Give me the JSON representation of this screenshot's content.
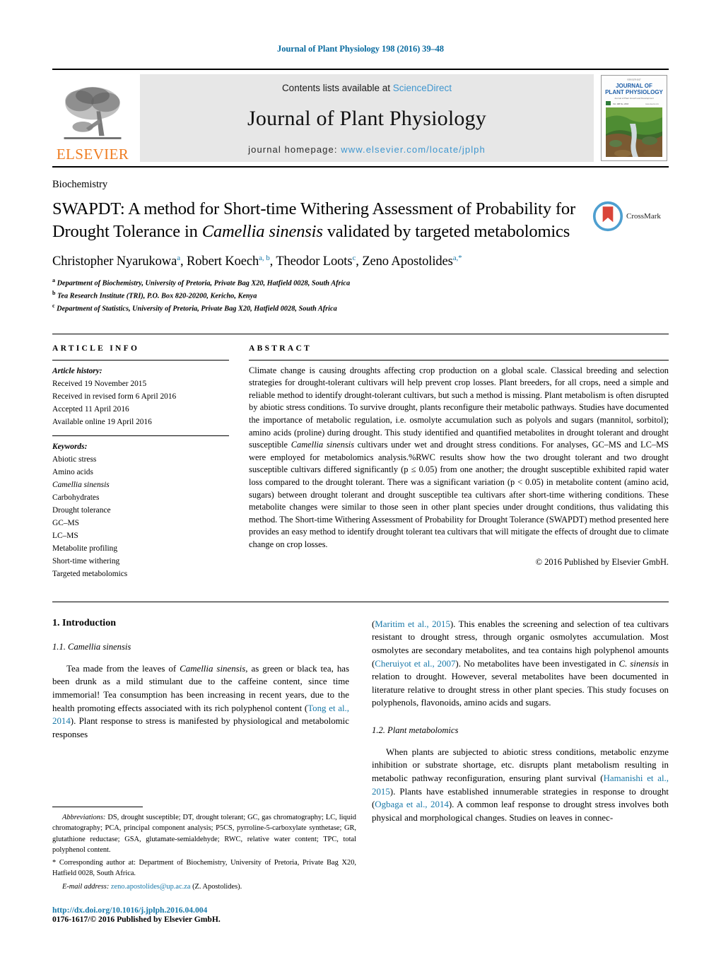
{
  "running_head": "Journal of Plant Physiology 198 (2016) 39–48",
  "masthead": {
    "contents_prefix": "Contents lists available at ",
    "sciencedirect": "ScienceDirect",
    "journal_name": "Journal of Plant Physiology",
    "homepage_prefix": "journal homepage: ",
    "homepage_url": "www.elsevier.com/locate/jplph",
    "publisher_wordmark": "ELSEVIER",
    "publisher_logo_icon": "elsevier-tree-icon",
    "cover_thumbnail_icon": "journal-cover-thumbnail",
    "cover_title_line1": "JOURNAL OF",
    "cover_title_line2": "PLANT PHYSIOLOGY"
  },
  "subject_category": "Biochemistry",
  "title": {
    "part1": "SWAPDT: A method for Short-time Withering Assessment of Probability for Drought Tolerance in ",
    "italic": "Camellia sinensis",
    "part2": " validated by targeted metabolomics"
  },
  "crossmark": {
    "label": "CrossMark",
    "icon": "crossmark-icon"
  },
  "authors": [
    {
      "name": "Christopher Nyarukowa",
      "marks": "a",
      "sep": ", "
    },
    {
      "name": "Robert Koech",
      "marks": "a, b",
      "sep": ", "
    },
    {
      "name": "Theodor Loots",
      "marks": "c",
      "sep": ", "
    },
    {
      "name": "Zeno Apostolides",
      "marks": "a,*",
      "sep": ""
    }
  ],
  "affiliations": [
    {
      "mark": "a",
      "text": "Department of Biochemistry, University of Pretoria, Private Bag X20, Hatfield 0028, South Africa"
    },
    {
      "mark": "b",
      "text": "Tea Research Institute (TRI), P.O. Box 820-20200, Kericho, Kenya"
    },
    {
      "mark": "c",
      "text": "Department of Statistics, University of Pretoria, Private Bag X20, Hatfield 0028, South Africa"
    }
  ],
  "article_info": {
    "heading": "ARTICLE INFO",
    "history_label": "Article history:",
    "history": [
      "Received 19 November 2015",
      "Received in revised form 6 April 2016",
      "Accepted 11 April 2016",
      "Available online 19 April 2016"
    ],
    "keywords_label": "Keywords:",
    "keywords": [
      {
        "text": "Abiotic stress",
        "italic": false
      },
      {
        "text": "Amino acids",
        "italic": false
      },
      {
        "text": "Camellia sinensis",
        "italic": true
      },
      {
        "text": "Carbohydrates",
        "italic": false
      },
      {
        "text": "Drought tolerance",
        "italic": false
      },
      {
        "text": "GC–MS",
        "italic": false
      },
      {
        "text": "LC–MS",
        "italic": false
      },
      {
        "text": "Metabolite profiling",
        "italic": false
      },
      {
        "text": "Short-time withering",
        "italic": false
      },
      {
        "text": "Targeted metabolomics",
        "italic": false
      }
    ]
  },
  "abstract": {
    "heading": "ABSTRACT",
    "text_part1": "Climate change is causing droughts affecting crop production on a global scale. Classical breeding and selection strategies for drought-tolerant cultivars will help prevent crop losses. Plant breeders, for all crops, need a simple and reliable method to identify drought-tolerant cultivars, but such a method is missing. Plant metabolism is often disrupted by abiotic stress conditions. To survive drought, plants reconfigure their metabolic pathways. Studies have documented the importance of metabolic regulation, i.e. osmolyte accumulation such as polyols and sugars (mannitol, sorbitol); amino acids (proline) during drought. This study identified and quantified metabolites in drought tolerant and drought susceptible ",
    "italic_species": "Camellia sinensis",
    "text_part2": " cultivars under wet and drought stress conditions. For analyses, GC–MS and LC–MS were employed for metabolomics analysis.%RWC results show how the two drought tolerant and two drought susceptible cultivars differed significantly (p ≤ 0.05) from one another; the drought susceptible exhibited rapid water loss compared to the drought tolerant. There was a significant variation (p < 0.05) in metabolite content (amino acid, sugars) between drought tolerant and drought susceptible tea cultivars after short-time withering conditions. These metabolite changes were similar to those seen in other plant species under drought conditions, thus validating this method. The Short-time Withering Assessment of Probability for Drought Tolerance (SWAPDT) method presented here provides an easy method to identify drought tolerant tea cultivars that will mitigate the effects of drought due to climate change on crop losses.",
    "copyright": "© 2016 Published by Elsevier GmbH."
  },
  "body": {
    "section1_heading": "1.  Introduction",
    "section11_heading": "1.1.  Camellia sinensis",
    "left_para1_a": "Tea made from the leaves of ",
    "left_para1_species": "Camellia sinensis",
    "left_para1_b": ", as green or black tea, has been drunk as a mild stimulant due to the caffeine content, since time immemorial! Tea consumption has been increasing in recent years, due to the health promoting effects associated with its rich polyphenol content (",
    "left_para1_cite": "Tong et al., 2014",
    "left_para1_c": "). Plant response to stress is manifested by physiological and metabolomic responses",
    "right_para1_cite1": "Maritim et al., 2015",
    "right_para1_a": "(",
    "right_para1_b": "). This enables the screening and selection of tea cultivars resistant to drought stress, through organic osmolytes accumulation. Most osmolytes are secondary metabolites, and tea contains high polyphenol amounts (",
    "right_para1_cite2": "Cheruiyot et al., 2007",
    "right_para1_c": "). No metabolites have been investigated in ",
    "right_para1_species": "C. sinensis",
    "right_para1_d": " in relation to drought. However, several metabolites have been documented in literature relative to drought stress in other plant species. This study focuses on polyphenols, flavonoids, amino acids and sugars.",
    "section12_heading": "1.2.  Plant metabolomics",
    "right_para2_a": "When plants are subjected to abiotic stress conditions, metabolic enzyme inhibition or substrate shortage, etc. disrupts plant metabolism resulting in metabolic pathway reconfiguration, ensuring plant survival (",
    "right_para2_cite1": "Hamanishi et al., 2015",
    "right_para2_b": "). Plants have established innumerable strategies in response to drought (",
    "right_para2_cite2": "Ogbaga et al., 2014",
    "right_para2_c": "). A common leaf response to drought stress involves both physical and morphological changes. Studies on leaves in connec-"
  },
  "footnotes": {
    "abbrev_label": "Abbreviations:",
    "abbrev_text": " DS, drought susceptible; DT, drought tolerant; GC, gas chromatography; LC, liquid chromatography; PCA, principal component analysis; P5CS, pyrroline-5-carboxylate synthetase; GR, glutathione reductase; GSA, glutamate-semialdehyde; RWC, relative water content; TPC, total polyphenol content.",
    "corresponding": "* Corresponding author at: Department of Biochemistry, University of Pretoria, Private Bag X20, Hatfield 0028, South Africa.",
    "email_label": "E-mail address:",
    "email": "zeno.apostolides@up.ac.za",
    "email_suffix": " (Z. Apostolides).",
    "doi": "http://dx.doi.org/10.1016/j.jplph.2016.04.004",
    "issn_line": "0176-1617/© 2016 Published by Elsevier GmbH."
  },
  "colors": {
    "link": "#1878a8",
    "running_head": "#0b6ca0",
    "elsevier_orange": "#ef7d22",
    "masthead_bg": "#e7e7e7",
    "sciencedirect_blue": "#3f96cf"
  }
}
